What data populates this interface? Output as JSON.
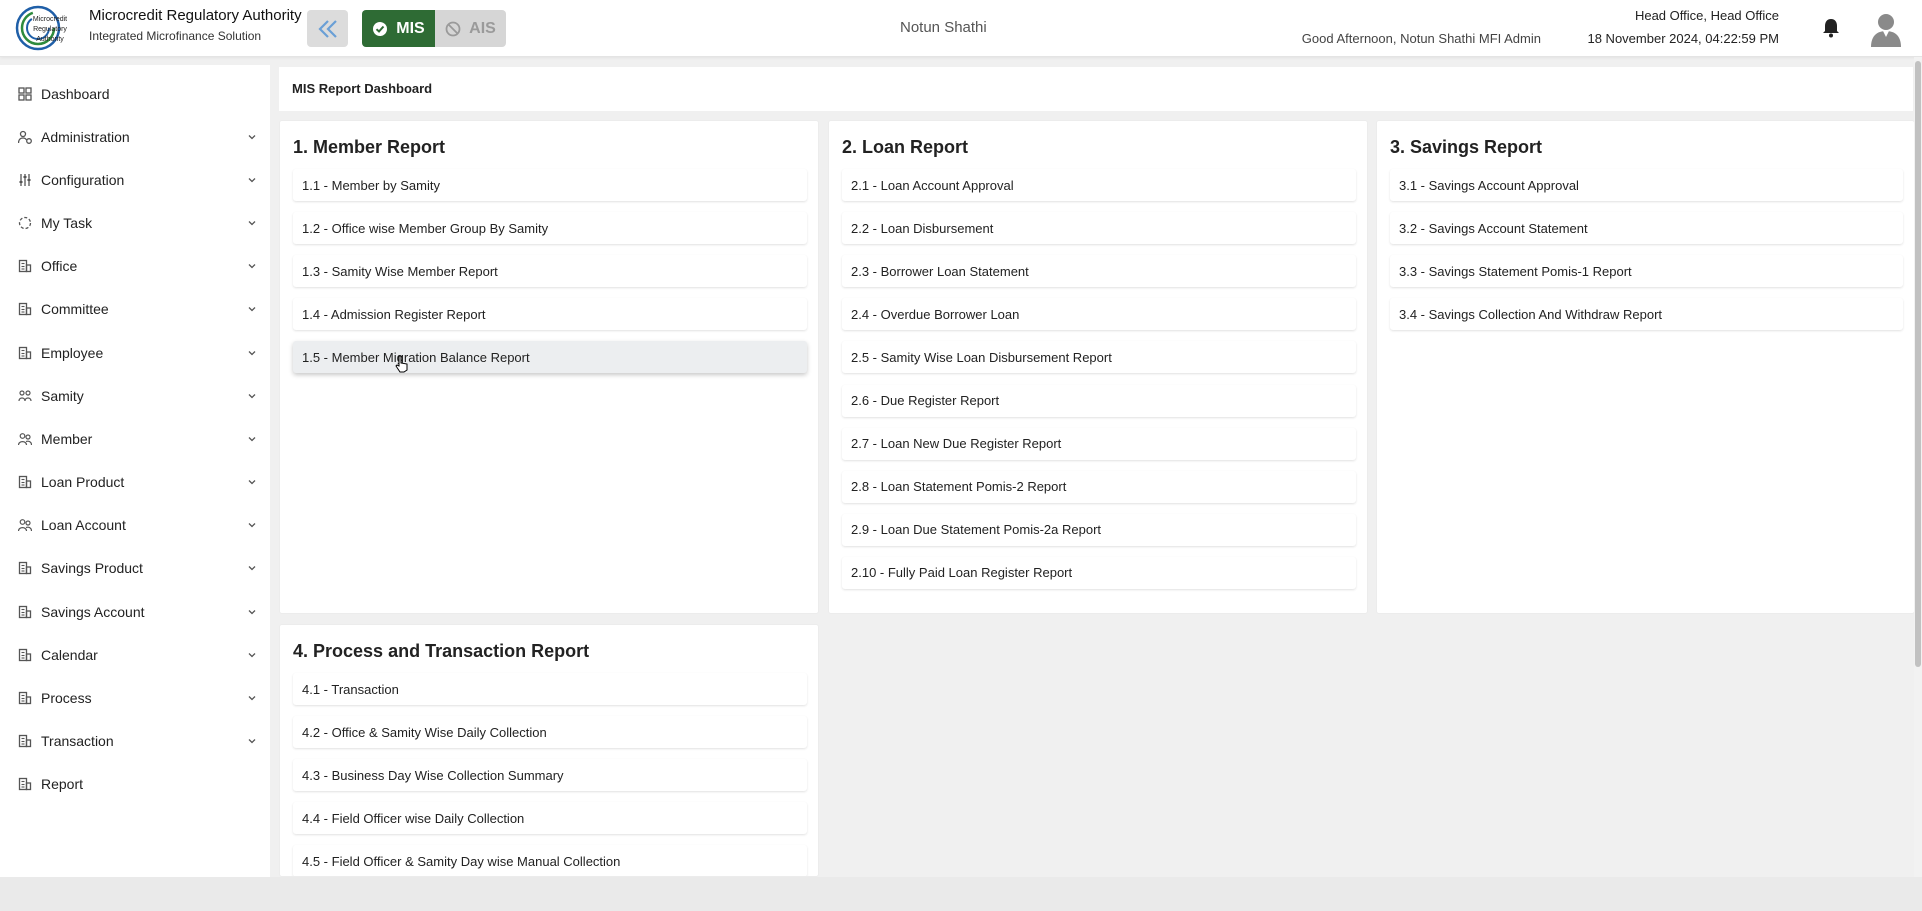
{
  "header": {
    "brand_title": "Microcredit Regulatory Authority",
    "brand_subtitle": "Integrated Microfinance Solution",
    "logo_text": [
      "Microcredit",
      "Regulatory",
      "Authority"
    ],
    "mode_mis": "MIS",
    "mode_ais": "AIS",
    "org_name": "Notun Shathi",
    "greeting": "Good Afternoon, Notun Shathi MFI Admin",
    "office": "Head Office, Head Office",
    "datetime": "18 November 2024, 04:22:59 PM"
  },
  "sidebar": {
    "items": [
      {
        "label": "Dashboard",
        "icon": "grid-icon",
        "chevron": false
      },
      {
        "label": "Administration",
        "icon": "users-cog-icon",
        "chevron": true
      },
      {
        "label": "Configuration",
        "icon": "sliders-icon",
        "chevron": true
      },
      {
        "label": "My Task",
        "icon": "circle-dashed-icon",
        "chevron": true
      },
      {
        "label": "Office",
        "icon": "building-icon",
        "chevron": true
      },
      {
        "label": "Committee",
        "icon": "building-icon",
        "chevron": true
      },
      {
        "label": "Employee",
        "icon": "building-icon",
        "chevron": true
      },
      {
        "label": "Samity",
        "icon": "group-icon",
        "chevron": true
      },
      {
        "label": "Member",
        "icon": "people-icon",
        "chevron": true
      },
      {
        "label": "Loan Product",
        "icon": "building-icon",
        "chevron": true
      },
      {
        "label": "Loan Account",
        "icon": "people-icon",
        "chevron": true
      },
      {
        "label": "Savings Product",
        "icon": "building-icon",
        "chevron": true
      },
      {
        "label": "Savings Account",
        "icon": "building-icon",
        "chevron": true
      },
      {
        "label": "Calendar",
        "icon": "building-icon",
        "chevron": true
      },
      {
        "label": "Process",
        "icon": "building-icon",
        "chevron": true
      },
      {
        "label": "Transaction",
        "icon": "building-icon",
        "chevron": true
      },
      {
        "label": "Report",
        "icon": "building-icon",
        "chevron": false
      }
    ]
  },
  "main": {
    "page_title": "MIS Report Dashboard",
    "sections": [
      {
        "title": "1. Member Report",
        "items": [
          "1.1 - Member by Samity",
          "1.2 - Office wise Member Group By Samity",
          "1.3 - Samity Wise Member Report",
          "1.4 - Admission Register Report",
          "1.5 - Member Migration Balance Report"
        ]
      },
      {
        "title": "2. Loan Report",
        "items": [
          "2.1 - Loan Account Approval",
          "2.2 - Loan Disbursement",
          "2.3 - Borrower Loan Statement",
          "2.4 - Overdue Borrower Loan",
          "2.5 - Samity Wise Loan Disbursement Report",
          "2.6 - Due Register Report",
          "2.7 - Loan New Due Register Report",
          "2.8 - Loan Statement Pomis-2 Report",
          "2.9 - Loan Due Statement Pomis-2a Report",
          "2.10 - Fully Paid Loan Register Report"
        ]
      },
      {
        "title": "3. Savings Report",
        "items": [
          "3.1 - Savings Account Approval",
          "3.2 - Savings Account Statement",
          "3.3 - Savings Statement Pomis-1 Report",
          "3.4 - Savings Collection And Withdraw Report"
        ]
      },
      {
        "title": "4. Process and Transaction Report",
        "items": [
          "4.1 - Transaction",
          "4.2 - Office & Samity Wise Daily Collection",
          "4.3 - Business Day Wise Collection Summary",
          "4.4 - Field Officer wise Daily Collection",
          "4.5 - Field Officer & Samity Day wise Manual Collection"
        ]
      }
    ]
  },
  "colors": {
    "mis_active": "#2e6b34",
    "ais_inactive": "#d6d6d6",
    "logo_blue": "#1f5fa8",
    "logo_green": "#2e8b3d"
  }
}
